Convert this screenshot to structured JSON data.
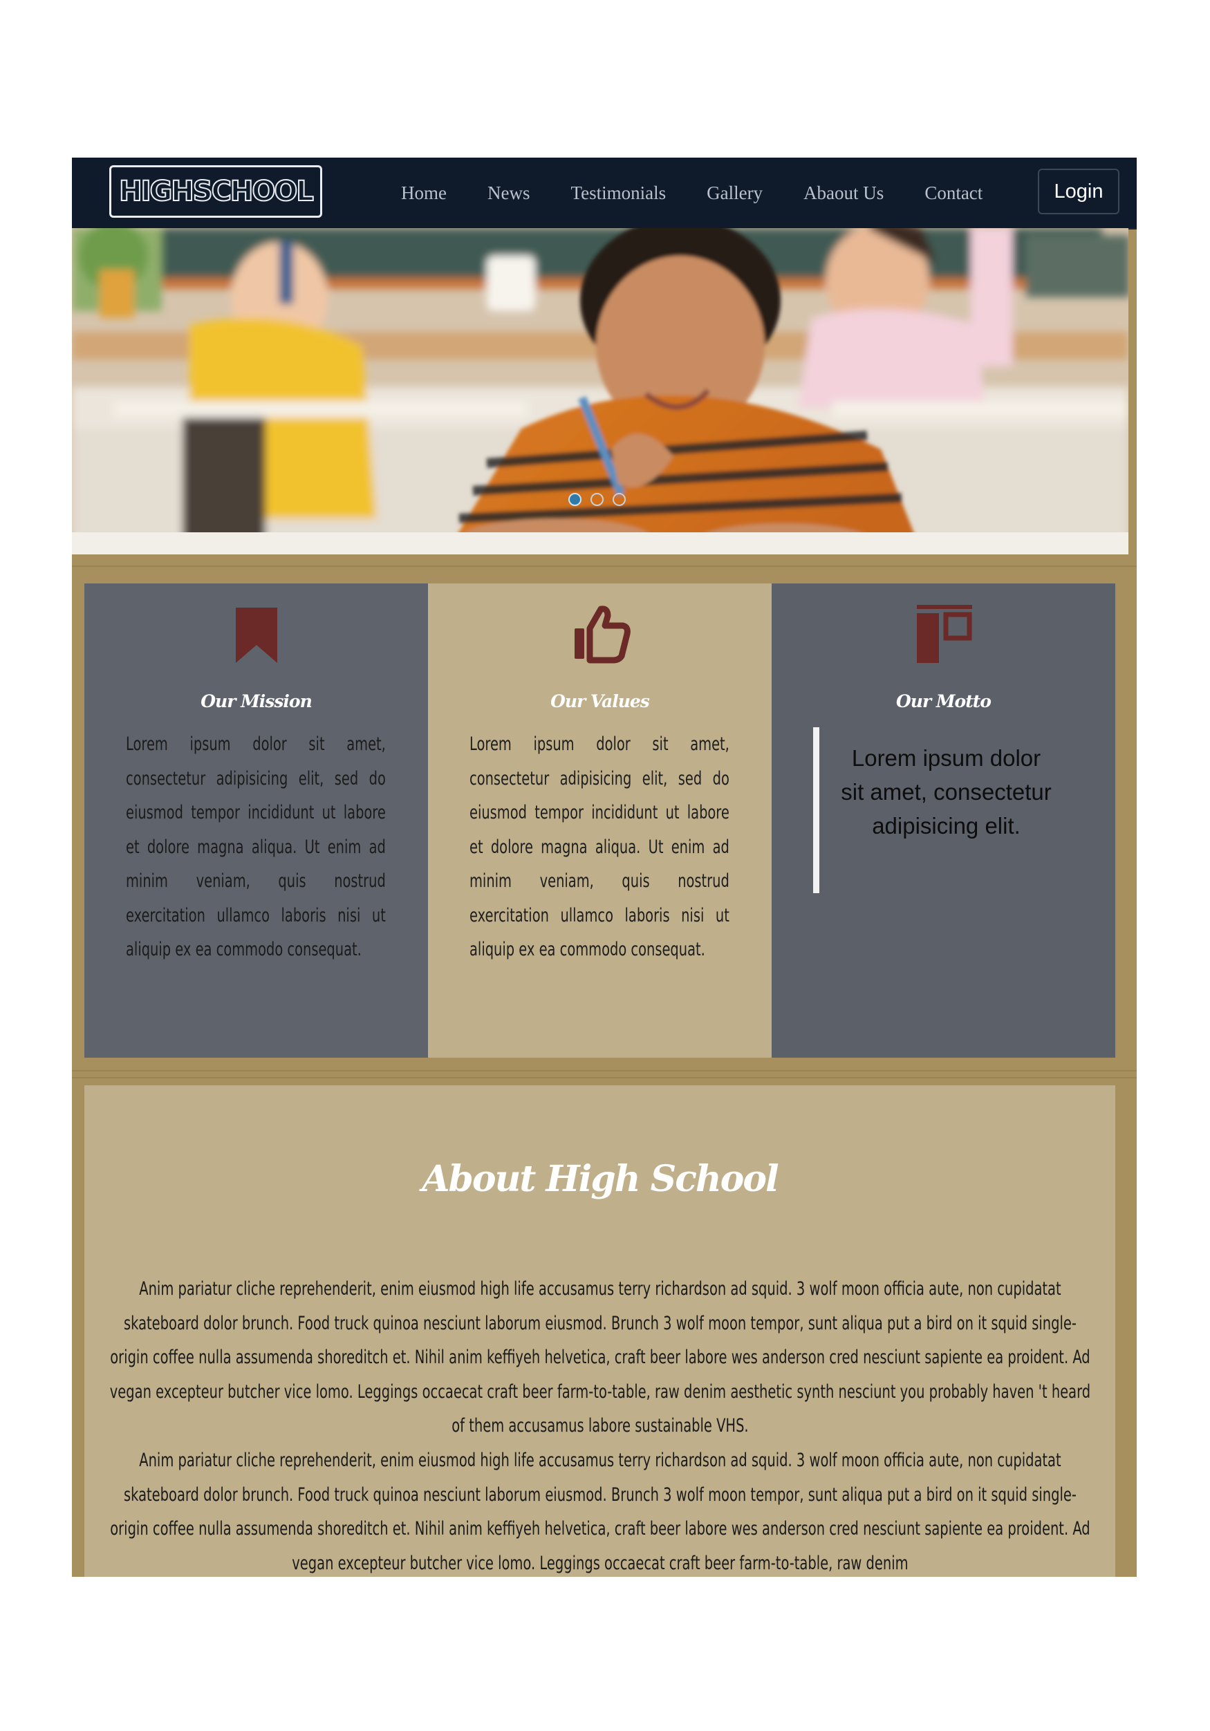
{
  "brand": {
    "logo_text": "HIGHSCHOOL"
  },
  "nav": {
    "links": [
      "Home",
      "News",
      "Testimonials",
      "Gallery",
      "Abaout Us",
      "Contact"
    ],
    "login_label": "Login"
  },
  "hero": {
    "slide_count": 3,
    "active_slide": 1
  },
  "features": [
    {
      "title": "Our Mission",
      "icon": "bookmark-icon",
      "text": "Lorem ipsum dolor sit amet, consectetur adipisicing elit, sed do eiusmod tempor incididunt ut labore et dolore magna aliqua. Ut enim ad minim veniam, quis nostrud exercitation ullamco laboris nisi ut aliquip ex ea commodo consequat."
    },
    {
      "title": "Our Values",
      "icon": "thumbs-up-icon",
      "text": "Lorem ipsum dolor sit amet, consectetur adipisicing elit, sed do eiusmod tempor incididunt ut labore et dolore magna aliqua. Ut enim ad minim veniam, quis nostrud exercitation ullamco laboris nisi ut aliquip ex ea commodo consequat."
    },
    {
      "title": "Our Motto",
      "icon": "layout-icon",
      "quote": "Lorem ipsum dolor sit amet, consectetur adipisicing elit."
    }
  ],
  "about": {
    "title": "About High School",
    "paragraphs": [
      "Anim pariatur cliche reprehenderit, enim eiusmod high life accusamus terry richardson ad squid. 3 wolf moon officia aute, non cupidatat skateboard dolor brunch. Food truck quinoa nesciunt laborum eiusmod. Brunch 3 wolf moon tempor, sunt aliqua put a bird on it squid single-origin coffee nulla assumenda shoreditch et. Nihil anim keffiyeh helvetica, craft beer labore wes anderson cred nesciunt sapiente ea proident. Ad vegan excepteur butcher vice lomo. Leggings occaecat craft beer farm-to-table, raw denim aesthetic synth nesciunt you probably haven 't heard of them accusamus labore sustainable VHS.",
      "Anim pariatur cliche reprehenderit, enim eiusmod high life accusamus terry richardson ad squid. 3 wolf moon officia aute, non cupidatat skateboard dolor brunch. Food truck quinoa nesciunt laborum eiusmod. Brunch 3 wolf moon tempor, sunt aliqua put a bird on it squid single-origin coffee nulla assumenda shoreditch et. Nihil anim keffiyeh helvetica, craft beer labore wes anderson cred nesciunt sapiente ea proident. Ad vegan excepteur butcher vice lomo. Leggings occaecat craft beer farm-to-table, raw denim"
    ]
  },
  "colors": {
    "navbar": "#0f1b2b",
    "wood": "#a88f5e",
    "panel_dark": "#5f646c",
    "panel_light": "#bfb08b",
    "icon_accent": "#6b2a28",
    "dot_active": "#2f7aa6"
  }
}
